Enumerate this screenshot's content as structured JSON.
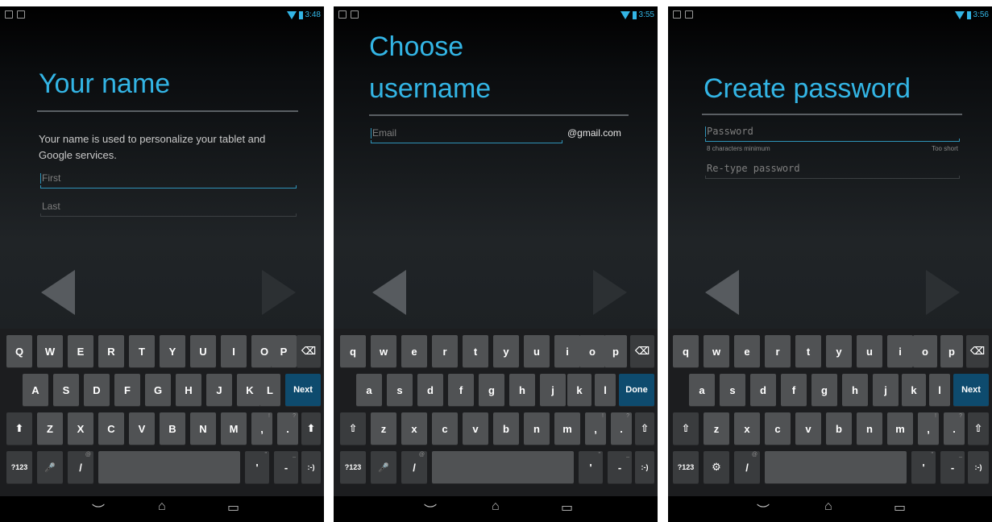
{
  "panels": [
    {
      "status": {
        "time": "3:48"
      },
      "title": "Your name",
      "description": "Your name is used to personalize your tablet and Google services.",
      "fields": [
        {
          "placeholder": "First",
          "focused": true
        },
        {
          "placeholder": "Last",
          "focused": false
        }
      ],
      "keyboard": {
        "row1": [
          "Q",
          "W",
          "E",
          "R",
          "T",
          "Y",
          "U",
          "I",
          "O",
          "P"
        ],
        "row2": [
          "A",
          "S",
          "D",
          "F",
          "G",
          "H",
          "J",
          "K",
          "L"
        ],
        "row3": [
          "Z",
          "X",
          "C",
          "V",
          "B",
          "N",
          "M",
          ",",
          "."
        ],
        "action_label": "Next",
        "symbols_label": "?123",
        "slash_label": "/",
        "apostrophe_label": "'",
        "dash_label": "-",
        "smiley_label": ":-)",
        "comma_alt": "!",
        "period_alt": "?",
        "slash_alt": "@",
        "dash_alt": "_",
        "apostrophe_alt": "\"",
        "shift_icon": "shift-filled-icon",
        "second_key_icon": "microphone-icon"
      }
    },
    {
      "status": {
        "time": "3:55"
      },
      "title_lines": [
        "Choose",
        "username"
      ],
      "fields": [
        {
          "placeholder": "Email",
          "focused": true
        }
      ],
      "suffix": "@gmail.com",
      "keyboard": {
        "row1": [
          "q",
          "w",
          "e",
          "r",
          "t",
          "y",
          "u",
          "i",
          "o",
          "p"
        ],
        "row2": [
          "a",
          "s",
          "d",
          "f",
          "g",
          "h",
          "j",
          "k",
          "l"
        ],
        "row3": [
          "z",
          "x",
          "c",
          "v",
          "b",
          "n",
          "m",
          ",",
          "."
        ],
        "action_label": "Done",
        "symbols_label": "?123",
        "slash_label": "/",
        "apostrophe_label": "'",
        "dash_label": "-",
        "smiley_label": ":-)",
        "comma_alt": "!",
        "period_alt": "?",
        "slash_alt": "@",
        "dash_alt": "_",
        "apostrophe_alt": "\"",
        "shift_icon": "shift-outline-icon",
        "second_key_icon": "microphone-icon"
      }
    },
    {
      "status": {
        "time": "3:56"
      },
      "title": "Create password",
      "fields": [
        {
          "placeholder": "Password",
          "focused": true
        },
        {
          "placeholder": "Re-type password",
          "focused": false
        }
      ],
      "hint_left": "8 characters minimum",
      "hint_right": "Too short",
      "keyboard": {
        "row1": [
          "q",
          "w",
          "e",
          "r",
          "t",
          "y",
          "u",
          "i",
          "o",
          "p"
        ],
        "row2": [
          "a",
          "s",
          "d",
          "f",
          "g",
          "h",
          "j",
          "k",
          "l"
        ],
        "row3": [
          "z",
          "x",
          "c",
          "v",
          "b",
          "n",
          "m",
          ",",
          "."
        ],
        "action_label": "Next",
        "symbols_label": "?123",
        "slash_label": "/",
        "apostrophe_label": "'",
        "dash_label": "-",
        "smiley_label": ":-)",
        "comma_alt": "!",
        "period_alt": "?",
        "slash_alt": "@",
        "dash_alt": "_",
        "apostrophe_alt": "\"",
        "shift_icon": "shift-outline-icon",
        "second_key_icon": "input-settings-icon"
      }
    }
  ],
  "glyphs": {
    "backspace": "⌫",
    "shift_filled": "⬆",
    "shift_outline": "⇧",
    "microphone": "🎤",
    "settings": "⚙",
    "nav_back": "︶",
    "nav_home": "⌂",
    "nav_recents": "▭"
  },
  "colors": {
    "accent": "#33b5e5",
    "action_key": "#0e4b6e",
    "key": "#505254"
  }
}
